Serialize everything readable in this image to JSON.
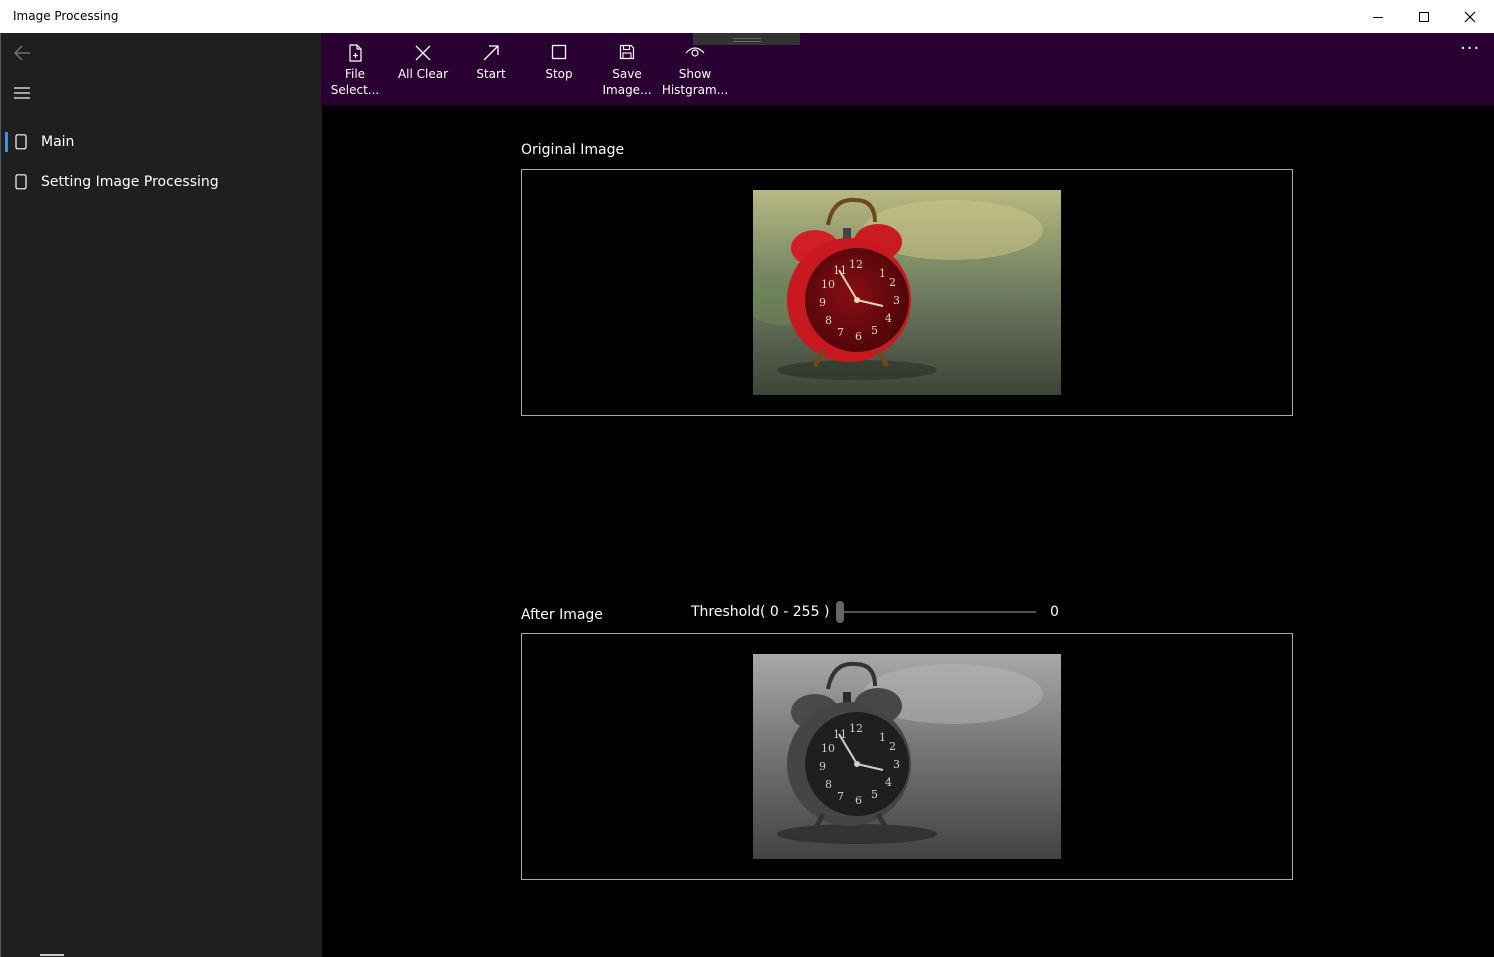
{
  "window": {
    "title": "Image Processing",
    "controls": [
      "minimize-icon",
      "maximize-icon",
      "close-icon"
    ]
  },
  "sidebar": {
    "back_icon": "back-arrow-icon",
    "menu_icon": "hamburger-icon",
    "items": [
      {
        "label": "Main",
        "icon": "page-icon",
        "selected": true
      },
      {
        "label": "Setting Image Processing",
        "icon": "page-icon",
        "selected": false
      }
    ]
  },
  "toolbar": {
    "background": "#2a0033",
    "commands": [
      {
        "label": "File Select...",
        "icon": "add-file-icon"
      },
      {
        "label": "All Clear",
        "icon": "close-x-icon"
      },
      {
        "label": "Start",
        "icon": "arrow-up-right-icon"
      },
      {
        "label": "Stop",
        "icon": "stop-square-icon"
      },
      {
        "label": "Save\nImage...",
        "icon": "save-disk-icon"
      },
      {
        "label": "Show\nHistgram...",
        "icon": "eye-icon"
      }
    ],
    "more_label": "···"
  },
  "main": {
    "original_label": "Original Image",
    "after_label": "After Image",
    "threshold": {
      "label": "Threshold( 0 - 255 )",
      "value": "0",
      "min": 0,
      "max": 255
    }
  },
  "accent": "#3a8ee6"
}
